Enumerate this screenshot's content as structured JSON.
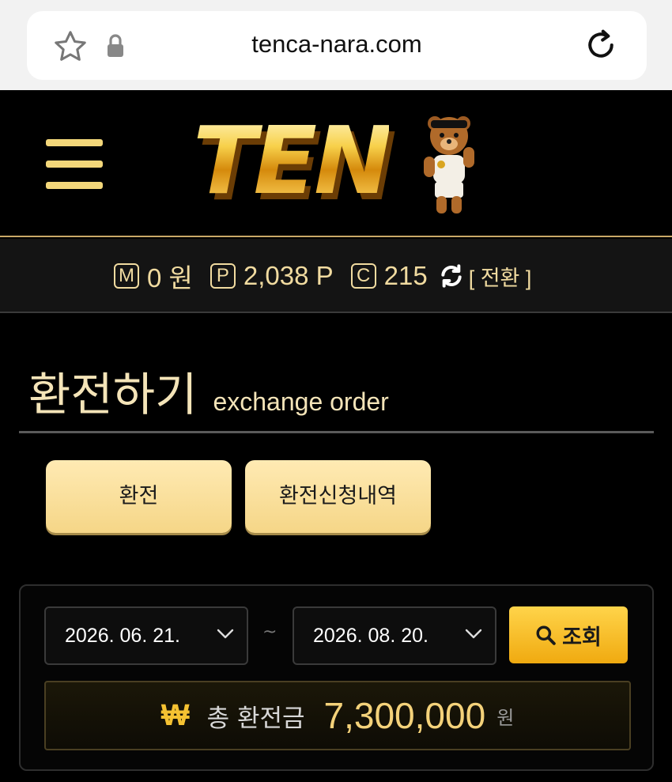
{
  "browser": {
    "url": "tenca-nara.com",
    "icons": [
      "star-icon",
      "lock-icon",
      "reload-icon"
    ]
  },
  "header": {
    "logo_text": "TEN",
    "icons": [
      "menu-icon",
      "bear-mascot-icon"
    ],
    "accent_color": "#f6c535"
  },
  "balance": {
    "money_badge": "M",
    "money": "0 원",
    "point_badge": "P",
    "points": "2,038 P",
    "coin_badge": "C",
    "coins": "215",
    "switch_label": "[ 전환 ]"
  },
  "page": {
    "title_ko": "환전하기",
    "title_en": "exchange order"
  },
  "tabs": [
    {
      "label": "환전"
    },
    {
      "label": "환전신청내역"
    }
  ],
  "search": {
    "date_from": "2026. 06. 21.",
    "separator": "~",
    "date_to": "2026. 08. 20.",
    "button_label": "조회"
  },
  "total": {
    "currency_symbol": "₩",
    "label": "총 환전금",
    "value": "7,300,000",
    "unit": "원"
  }
}
